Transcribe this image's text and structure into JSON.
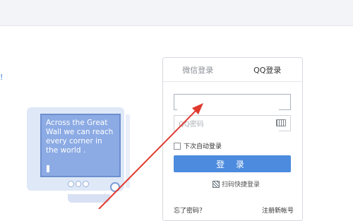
{
  "topbar": {},
  "left_edge_text": "!",
  "illustration": {
    "screen_text": "Across the Great Wall we can reach every corner in the world ."
  },
  "login": {
    "tabs": [
      {
        "label": "微信登录",
        "active": false
      },
      {
        "label": "QQ登录",
        "active": true
      }
    ],
    "account_value": "",
    "password_placeholder": "QQ密码",
    "remember_label": "下次自动登录",
    "login_button": "登 录",
    "qr_login": "扫码快捷登录",
    "forgot_password": "忘了密码？",
    "register": "注册新帐号"
  },
  "colors": {
    "accent": "#4c8bde",
    "arrow": "#e03a2f"
  }
}
